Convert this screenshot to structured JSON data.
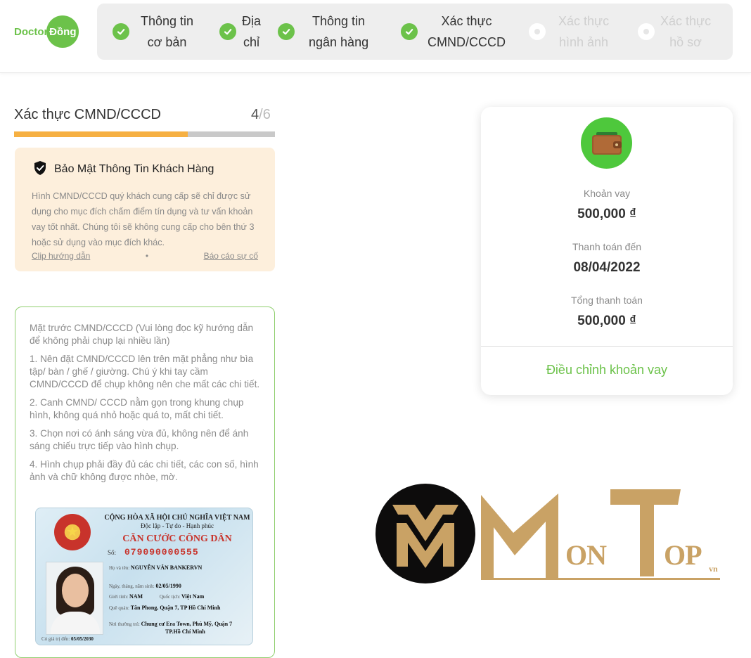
{
  "brand": {
    "logo_text": "Doctor",
    "logo_badge": "Đồng",
    "color_primary": "#6cc24a",
    "color_accent": "#f6b042"
  },
  "stepper": {
    "steps": [
      {
        "label": "Thông tin\ncơ bản",
        "status": "done"
      },
      {
        "label": "Địa\nchỉ",
        "status": "done"
      },
      {
        "label": "Thông tin\nngân hàng",
        "status": "done"
      },
      {
        "label": "Xác thực\nCMND/CCCD",
        "status": "done"
      },
      {
        "label": "Xác thực\nhình ảnh",
        "status": "pending"
      },
      {
        "label": "Xác thực\nhồ sơ",
        "status": "pending"
      }
    ]
  },
  "section": {
    "title": "Xác thực CMND/CCCD",
    "current_step": "4",
    "step_separator": "/",
    "total_steps": "6",
    "progress_fraction": 0.667
  },
  "privacy": {
    "icon": "shield-check-icon",
    "title": "Bảo Mật Thông Tin Khách Hàng",
    "body": "Hình CMND/CCCD quý khách cung cấp sẽ chỉ được sử dụng cho mục đích chấm điểm tín dụng và tư vấn khoản vay tốt nhất. Chúng tôi sẽ không cung cấp cho bên thứ 3 hoặc sử dụng vào mục đích khác.",
    "link_video": "Clip hướng dẫn",
    "separator": "•",
    "link_report": "Báo cáo sự cố"
  },
  "guide": {
    "intro": "Mặt trước CMND/CCCD (Vui lòng đọc kỹ hướng dẫn để không phải chụp lại nhiều lần)",
    "items": [
      "1. Nên đặt CMND/CCCD lên trên mặt phẳng như bìa tập/ bàn / ghế / giường. Chú ý khi tay cầm CMND/CCCD để chụp không nên che mất các chi tiết.",
      "2. Canh CMND/ CCCD nằm gọn trong khung chụp hình, không quá nhỏ hoặc quá to, mất chi tiết.",
      "3. Chọn nơi có ánh sáng vừa đủ, không nên để ánh sáng chiếu trực tiếp vào hình chụp.",
      "4. Hình chụp phải đầy đủ các chi tiết, các con số, hình ảnh và chữ không được nhòe, mờ."
    ]
  },
  "id_card": {
    "nation": "CỘNG HÒA XÃ HỘI CHỦ NGHĨA VIỆT NAM",
    "motto": "Độc lập - Tự do - Hạnh phúc",
    "title": "CĂN CƯỚC CÔNG DÂN",
    "number_label": "Số:",
    "number": "079090000555",
    "name_label": "Họ và tên:",
    "name": "NGUYỄN VĂN BANKERVN",
    "dob_label": "Ngày, tháng, năm sinh:",
    "dob": "02/05/1990",
    "sex_label": "Giới tính:",
    "sex": "NAM",
    "nationality_label": "Quốc tịch:",
    "nationality": "Việt Nam",
    "hometown_label": "Quê quán:",
    "hometown": "Tân Phong, Quận 7, TP Hồ Chí Minh",
    "residence_label": "Nơi thường trú:",
    "residence_line1": "Chung cư Era Town, Phú Mỹ, Quận 7",
    "residence_line2": "TP.Hồ Chí Minh",
    "expiry_label": "Có giá trị đến:",
    "expiry": "05/05/2030"
  },
  "loan": {
    "icon": "wallet-icon",
    "amount_label": "Khoản vay",
    "amount": "500,000 ₫",
    "due_label": "Thanh toán đến",
    "due_date": "08/04/2022",
    "total_label": "Tổng thanh toán",
    "total": "500,000 ₫",
    "adjust_label": "Điều chỉnh khoản vay"
  },
  "watermark": {
    "text_main": "MONTOP",
    "text_suffix": "vn",
    "color": "#c9a265"
  }
}
